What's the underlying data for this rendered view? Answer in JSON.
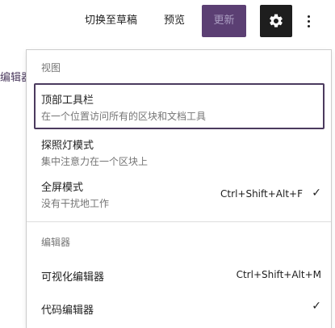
{
  "toolbar": {
    "save_draft_label": "切换至草稿",
    "preview_label": "预览",
    "update_label": "更新",
    "settings_icon": "gear-icon",
    "more_icon": "vertical-ellipsis-icon"
  },
  "background": {
    "editor_label": "编辑器"
  },
  "menu": {
    "view_group": {
      "label": "视图",
      "items": [
        {
          "title": "顶部工具栏",
          "description": "在一个位置访问所有的区块和文档工具",
          "focused": true,
          "checked": false
        },
        {
          "title": "探照灯模式",
          "description": "集中注意力在一个区块上",
          "checked": false
        },
        {
          "title": "全屏模式",
          "description": "没有干扰地工作",
          "shortcut": "Ctrl+Shift+Alt+F",
          "checked": true
        }
      ]
    },
    "editor_group": {
      "label": "编辑器",
      "items": [
        {
          "title": "可视化编辑器",
          "shortcut": "Ctrl+Shift+Alt+M",
          "checked": false
        },
        {
          "title": "代码编辑器",
          "checked": true
        }
      ]
    },
    "check_glyph": "✓"
  },
  "colors": {
    "accent": "#5b3f73",
    "focus_border": "#4b3a5e",
    "dark_button": "#1e1e1e"
  }
}
